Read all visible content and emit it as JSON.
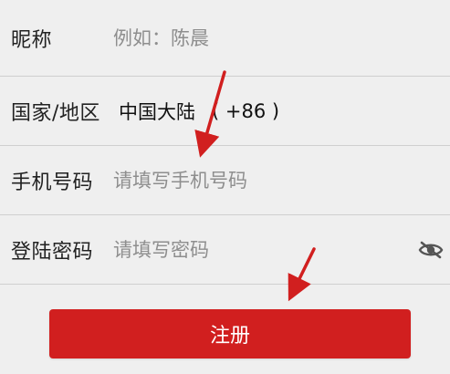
{
  "form": {
    "nickname": {
      "label": "昵称",
      "placeholder": "例如：陈晨"
    },
    "region": {
      "label": "国家/地区",
      "value": "中国大陆",
      "code": "( +86 )"
    },
    "phone": {
      "label": "手机号码",
      "placeholder": "请填写手机号码"
    },
    "password": {
      "label": "登陆密码",
      "placeholder": "请填写密码",
      "visibility_icon": "eye-off-icon"
    }
  },
  "actions": {
    "register_label": "注册"
  },
  "colors": {
    "primary": "#d11f1f",
    "annotation": "#d11f1f",
    "background": "#efefef"
  }
}
